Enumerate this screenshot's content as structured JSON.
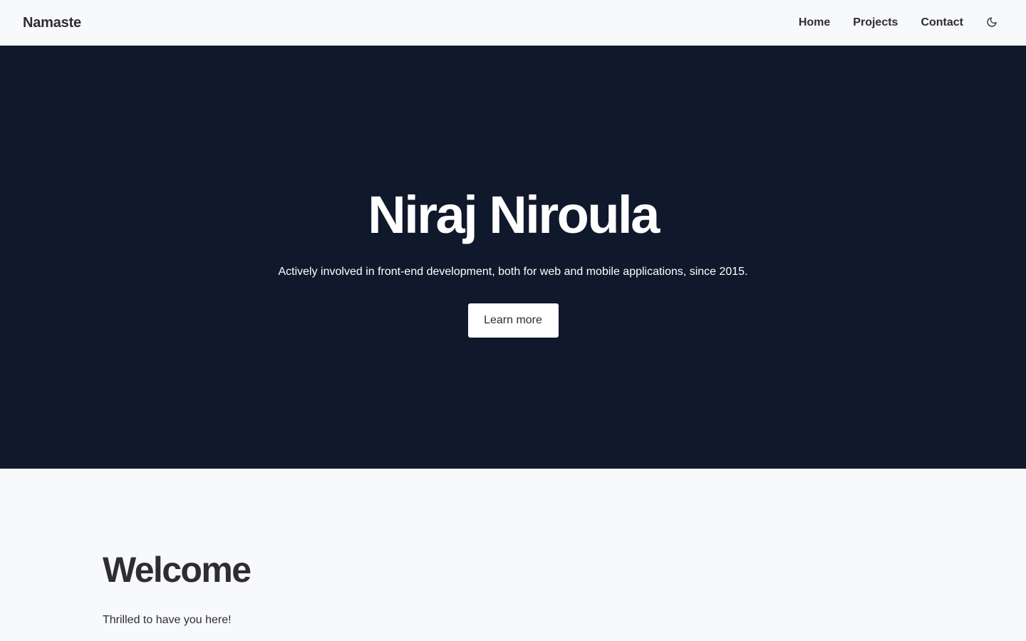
{
  "navbar": {
    "brand": "Namaste",
    "links": [
      "Home",
      "Projects",
      "Contact"
    ],
    "theme_toggle_icon": "moon-icon"
  },
  "hero": {
    "title": "Niraj Niroula",
    "subtitle": "Actively involved in front-end development, both for web and mobile applications, since 2015.",
    "button_label": "Learn more",
    "background": "#10182b"
  },
  "welcome": {
    "title": "Welcome",
    "text": "Thrilled to have you here!"
  },
  "colors": {
    "page_background": "#f8f9fb",
    "text": "#2d2d33",
    "hero_text": "#ffffff"
  }
}
